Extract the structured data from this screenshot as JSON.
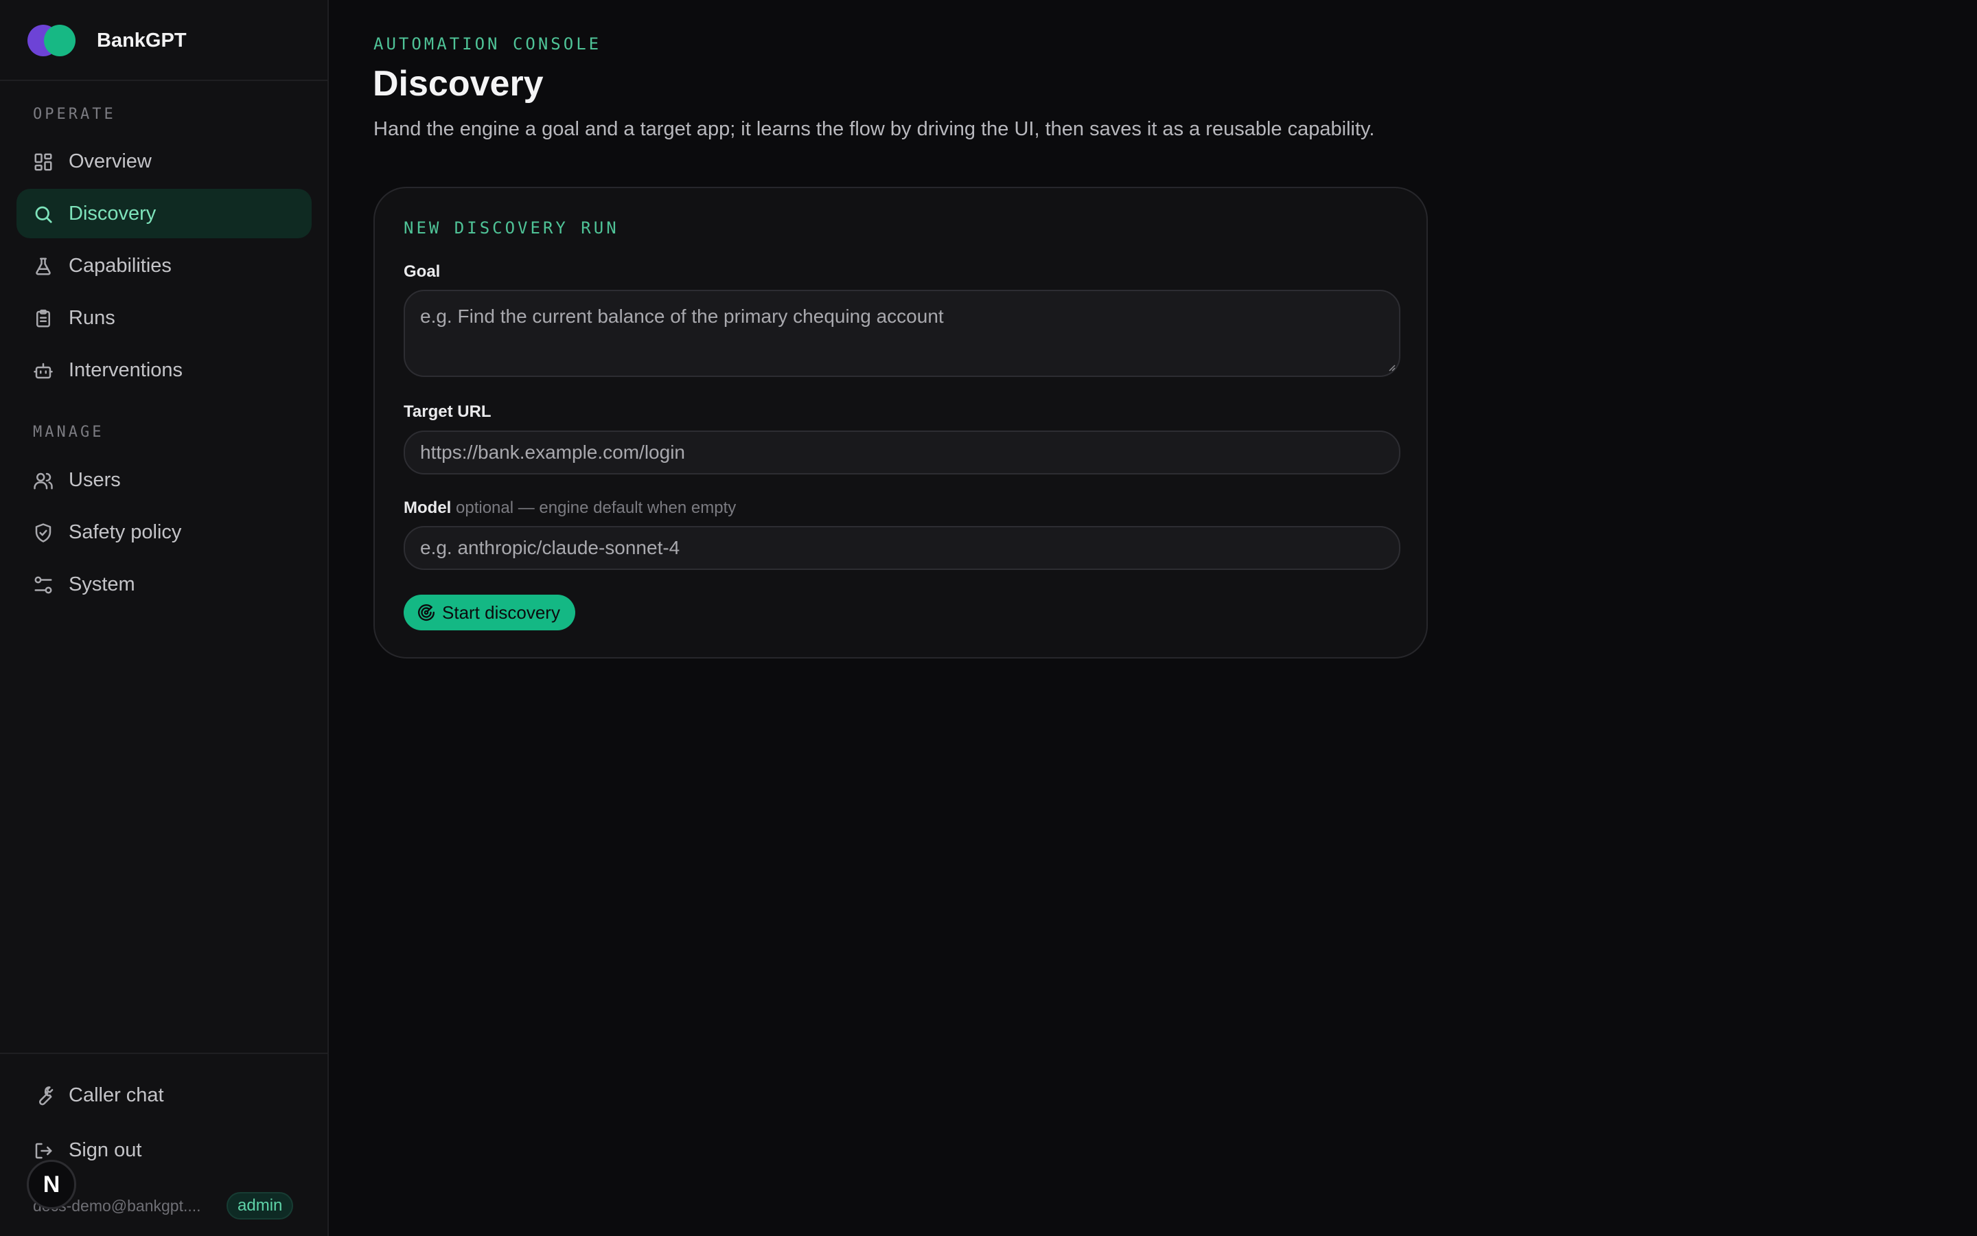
{
  "brand": {
    "name": "BankGPT"
  },
  "sidebar": {
    "sections": [
      {
        "title": "OPERATE"
      },
      {
        "title": "MANAGE"
      }
    ],
    "items": [
      {
        "label": "Overview",
        "icon": "dashboard-icon"
      },
      {
        "label": "Discovery",
        "icon": "search-icon",
        "active": true
      },
      {
        "label": "Capabilities",
        "icon": "flask-icon"
      },
      {
        "label": "Runs",
        "icon": "clipboard-icon"
      },
      {
        "label": "Interventions",
        "icon": "robot-icon"
      },
      {
        "label": "Users",
        "icon": "users-icon"
      },
      {
        "label": "Safety policy",
        "icon": "shield-check-icon"
      },
      {
        "label": "System",
        "icon": "sliders-icon"
      }
    ],
    "footer": {
      "items": [
        {
          "label": "Caller chat",
          "icon": "wrench-icon"
        },
        {
          "label": "Sign out",
          "icon": "sign-out-icon"
        }
      ],
      "user_email": "docs-demo@bankgpt....",
      "role": "admin",
      "overlay_badge": "N"
    }
  },
  "page": {
    "eyebrow": "AUTOMATION CONSOLE",
    "title": "Discovery",
    "subtitle": "Hand the engine a goal and a target app; it learns the flow by driving the UI, then saves it as a reusable capability."
  },
  "form": {
    "title": "NEW DISCOVERY RUN",
    "goal": {
      "label": "Goal",
      "placeholder": "e.g. Find the current balance of the primary chequing account",
      "value": ""
    },
    "target_url": {
      "label": "Target URL",
      "placeholder": "https://bank.example.com/login",
      "value": ""
    },
    "model": {
      "label": "Model",
      "hint": "optional — engine default when empty",
      "placeholder": "e.g. anthropic/claude-sonnet-4",
      "value": ""
    },
    "submit_label": "Start discovery",
    "submit_icon": "radar-icon"
  },
  "colors": {
    "accent": "#14b884",
    "accent_text": "#4fc397",
    "background": "#0b0b0d",
    "sidebar_bg": "#111113",
    "logo_purple": "#6d43d6",
    "logo_green": "#17b884"
  }
}
